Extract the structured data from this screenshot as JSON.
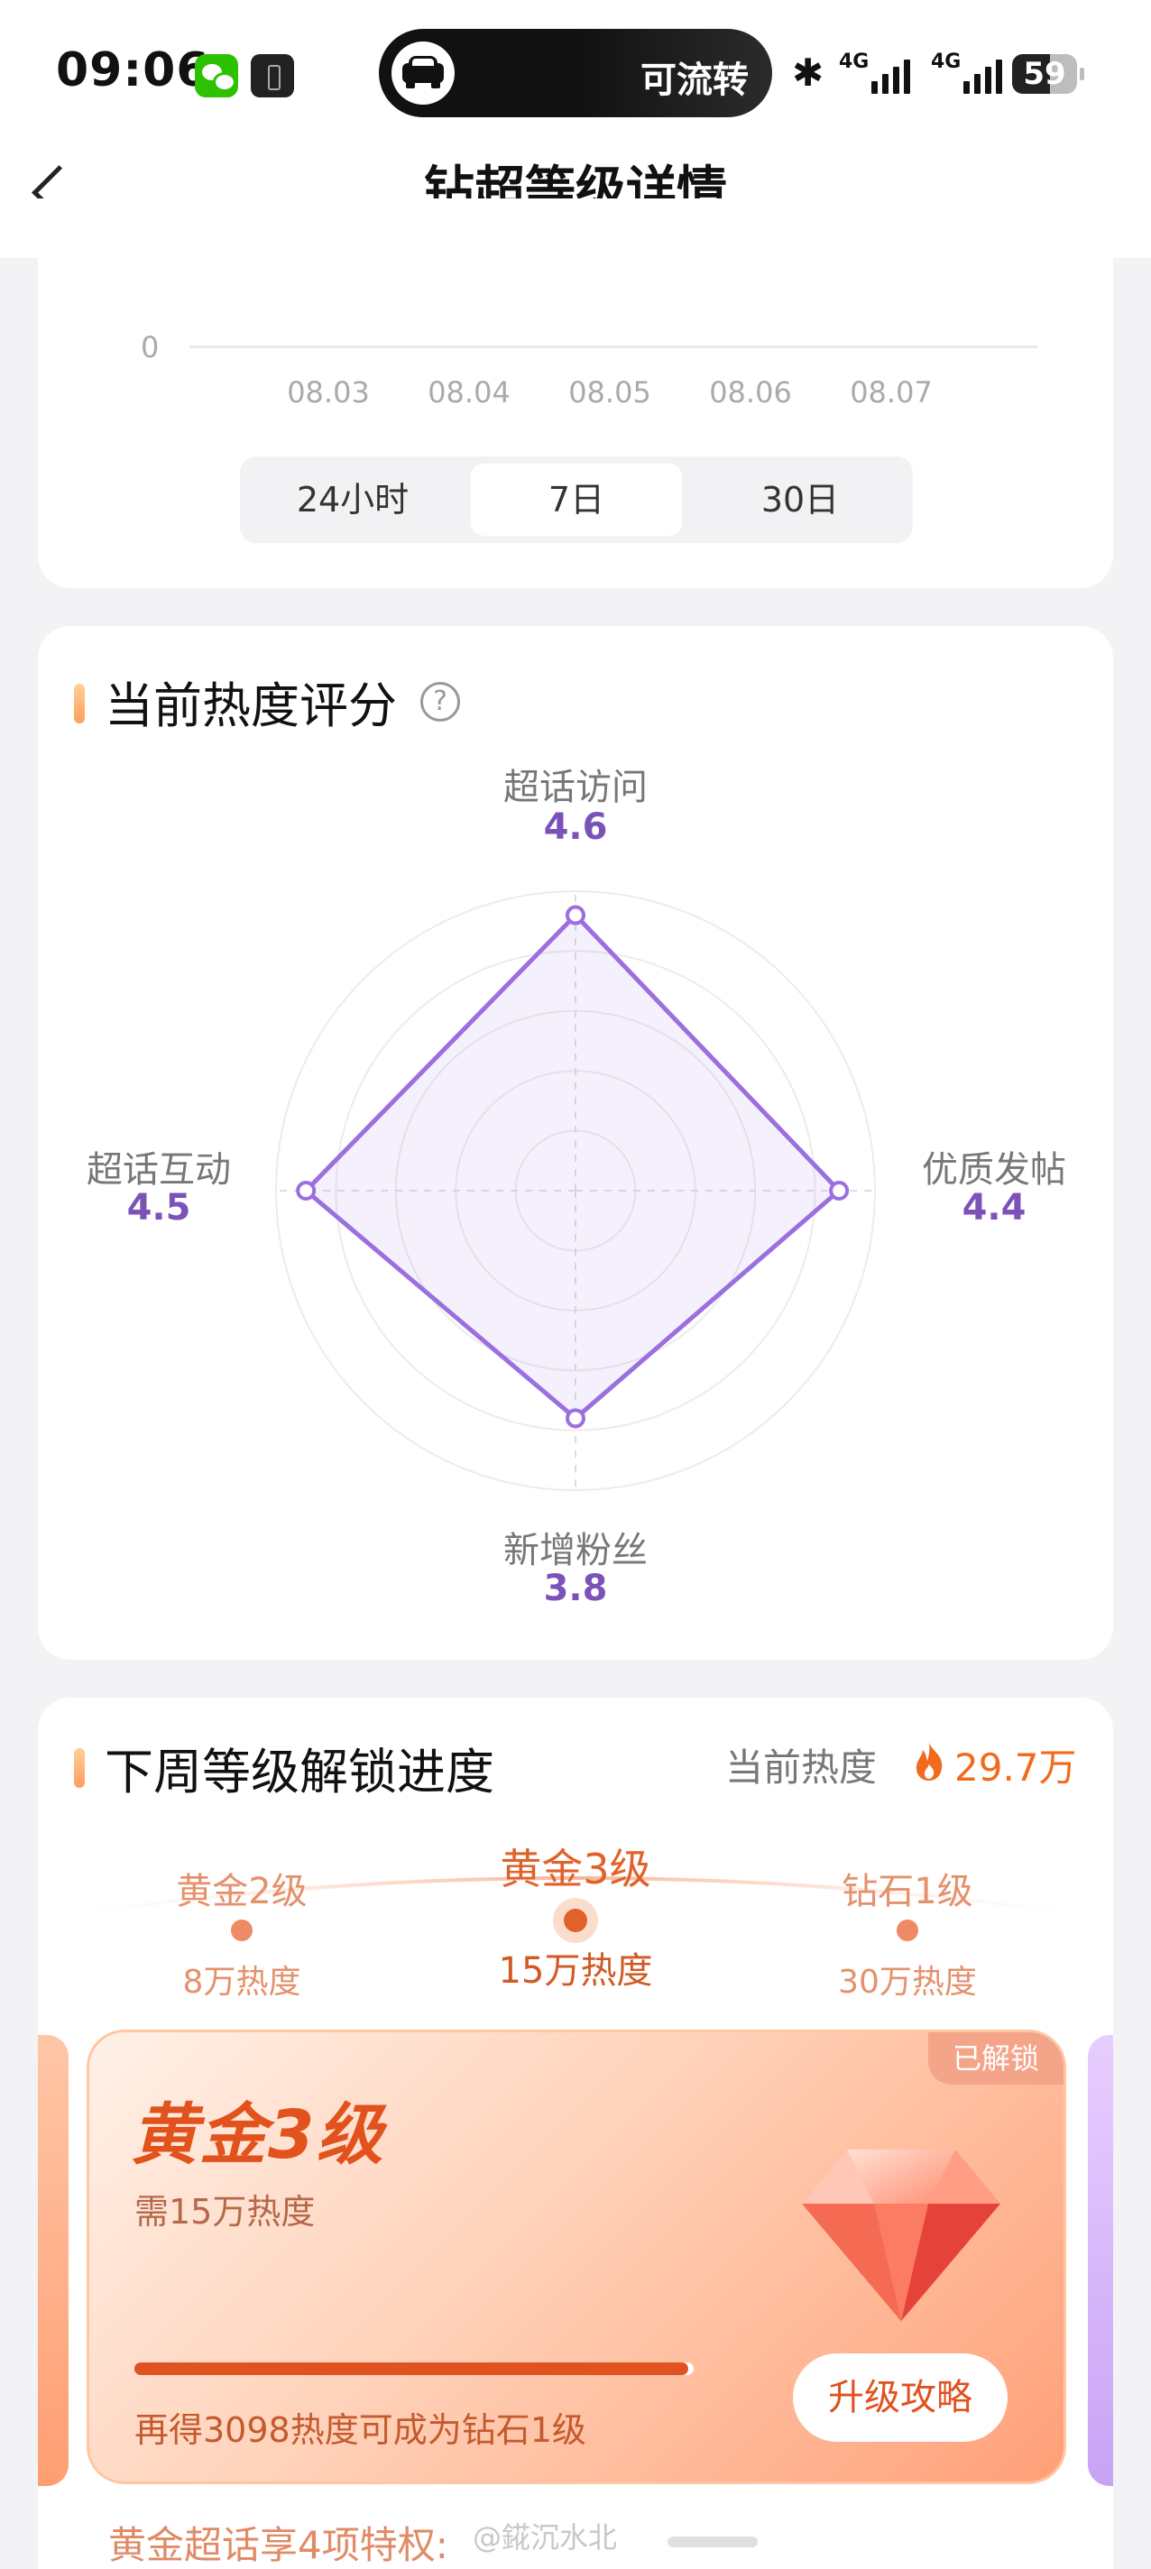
{
  "status_bar": {
    "time": "09:06",
    "pill_text": "可流转",
    "network_1": "4G",
    "network_2": "4G",
    "battery": "59",
    "battery_level": 0.59,
    "icons": [
      "wechat-icon",
      "app-icon",
      "car-icon",
      "bluetooth-icon",
      "signal-icon",
      "battery-icon"
    ]
  },
  "nav": {
    "title": "钻超等级详情",
    "back_icon": "back-arrow-icon"
  },
  "trend_chart": {
    "y_zero": "0",
    "x_ticks": [
      "08.03",
      "08.04",
      "08.05",
      "08.06",
      "08.07"
    ],
    "ranges": [
      "24小时",
      "7日",
      "30日"
    ],
    "active_range": "7日"
  },
  "heat_score": {
    "title": "当前热度评分",
    "help_icon": "?",
    "colors": {
      "accent": "#9b6fe0",
      "value": "#7b52b8"
    }
  },
  "chart_data": {
    "type": "radar",
    "axes": [
      "超话访问",
      "优质发帖",
      "新增粉丝",
      "超话互动"
    ],
    "values": [
      4.6,
      4.4,
      3.8,
      4.5
    ],
    "value_labels": [
      "4.6",
      "4.4",
      "3.8",
      "4.5"
    ],
    "range": [
      0,
      5
    ],
    "grid": true
  },
  "progress": {
    "title": "下周等级解锁进度",
    "current_heat_label": "当前热度",
    "current_heat_value": "29.7万",
    "levels": [
      {
        "name": "黄金2级",
        "req": "8万热度"
      },
      {
        "name": "黄金3级",
        "req": "15万热度"
      },
      {
        "name": "钻石1级",
        "req": "30万热度"
      }
    ],
    "card": {
      "badge": "已解锁",
      "title": "黄金3级",
      "need": "需15万热度",
      "progress": 0.99,
      "hint": "再得3098热度可成为钻石1级",
      "button": "升级攻略"
    },
    "privilege_text": "黄金超话享4项特权:",
    "watermark": "@錵沉水北",
    "colors": {
      "accent": "#e0521f"
    }
  }
}
